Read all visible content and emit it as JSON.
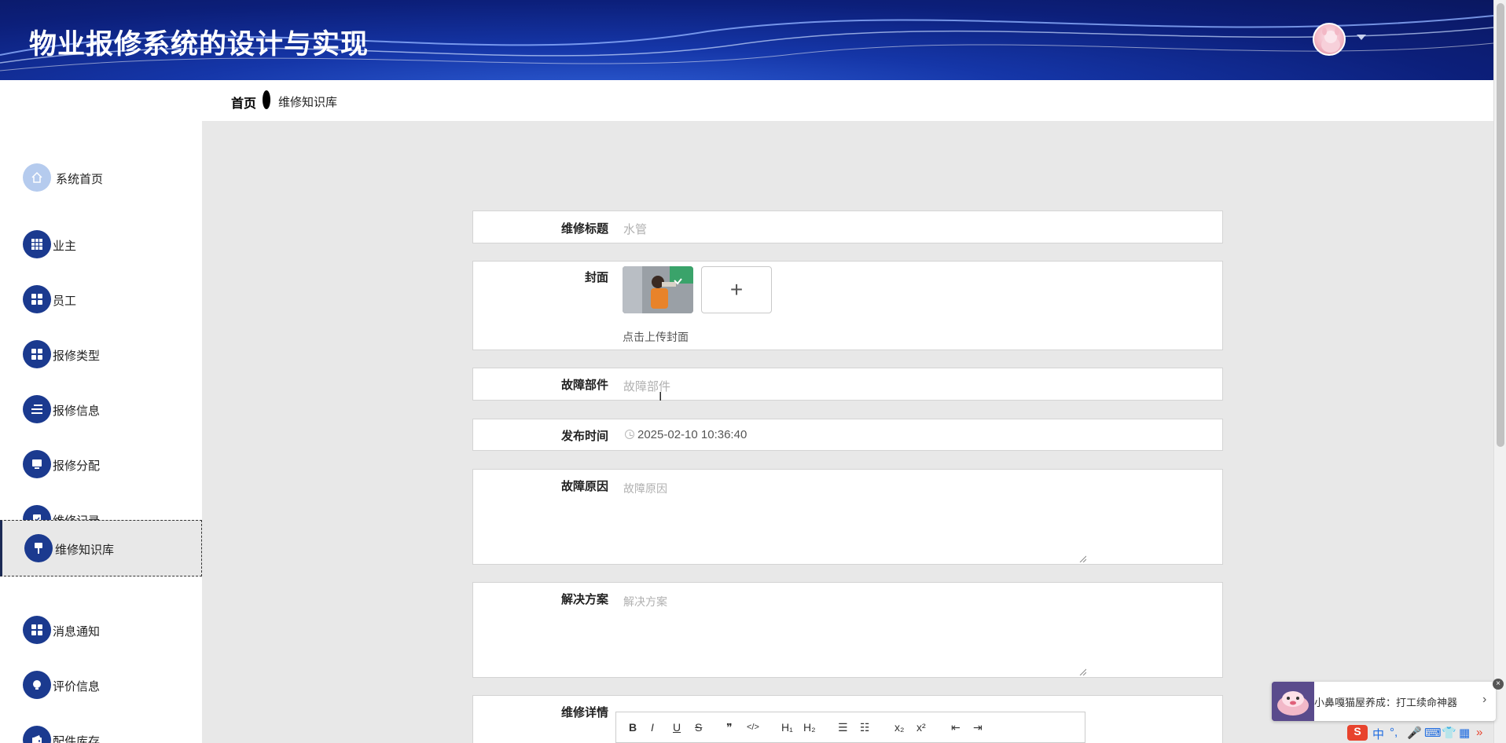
{
  "header": {
    "title": "物业报修系统的设计与实现",
    "avatar_icon": "user-avatar"
  },
  "breadcrumb": {
    "home": "首页",
    "current": "维修知识库"
  },
  "sidebar": {
    "items": [
      {
        "label": "系统首页",
        "icon": "home-icon"
      },
      {
        "label": "业主",
        "icon": "grid-icon"
      },
      {
        "label": "员工",
        "icon": "grid-icon"
      },
      {
        "label": "报修类型",
        "icon": "grid-icon"
      },
      {
        "label": "报修信息",
        "icon": "list-icon"
      },
      {
        "label": "报修分配",
        "icon": "monitor-icon"
      },
      {
        "label": "维修记录",
        "icon": "clipboard-icon"
      },
      {
        "label": "维修知识库",
        "icon": "brush-icon"
      },
      {
        "label": "消息通知",
        "icon": "grid-icon"
      },
      {
        "label": "评价信息",
        "icon": "bulb-icon"
      },
      {
        "label": "配件库存",
        "icon": "wallet-icon"
      }
    ],
    "active_index": 7
  },
  "form": {
    "title": {
      "label": "维修标题",
      "value": "水管"
    },
    "cover": {
      "label": "封面",
      "tip": "点击上传封面",
      "plus": "+"
    },
    "part": {
      "label": "故障部件",
      "placeholder": "故障部件"
    },
    "time": {
      "label": "发布时间",
      "value": "2025-02-10 10:36:40"
    },
    "cause": {
      "label": "故障原因",
      "placeholder": "故障原因"
    },
    "solution": {
      "label": "解决方案",
      "placeholder": "解决方案"
    },
    "detail": {
      "label": "维修详情",
      "toolbar": [
        "B",
        "I",
        "U",
        "S",
        "❞",
        "</>",
        "H₁",
        "H₂",
        "☰",
        "☷",
        "x₂",
        "x²",
        "⇤",
        "⇥"
      ]
    }
  },
  "notification": {
    "text": "小鼻嘎猫屋养成：打工续命神器",
    "arrow": "›",
    "close": "×"
  },
  "tray": {
    "ime": "中"
  },
  "colors": {
    "header_bg": "#0c1f7a",
    "nav_icon_bg": "#1b3a8f",
    "home_icon_bg": "#b5cbee",
    "main_bg": "#e8e8e8"
  }
}
